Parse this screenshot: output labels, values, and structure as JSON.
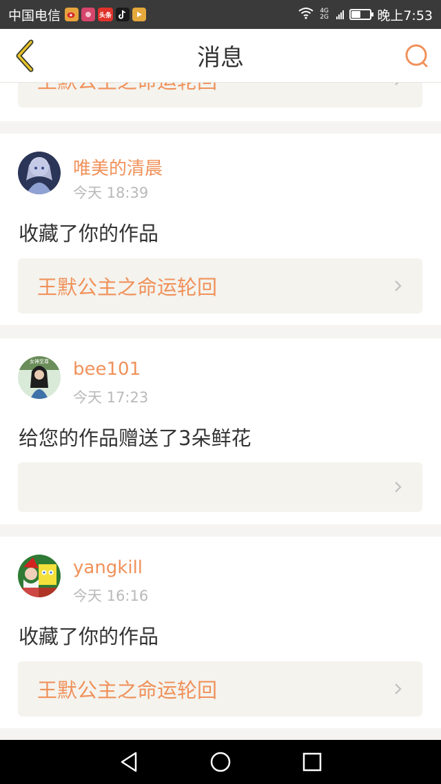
{
  "status_bar": {
    "carrier": "中国电信",
    "apps": [
      "weibo-icon",
      "app-red-icon",
      "toutiao-icon",
      "tiktok-icon",
      "video-icon"
    ],
    "toutiao_label": "头条",
    "network": "4G\n2G",
    "battery_level": 0.45,
    "time": "晚上7:53"
  },
  "header": {
    "title": "消息"
  },
  "top_card": {
    "work_title": "王默公主之命运轮回"
  },
  "notifications": [
    {
      "username": "唯美的清晨",
      "time": "今天 18:39",
      "message": "收藏了你的作品",
      "work_title": "王默公主之命运轮回"
    },
    {
      "username": "bee101",
      "time": "今天 17:23",
      "message": "给您的作品赠送了3朵鲜花",
      "work_title": ""
    },
    {
      "username": "yangkill",
      "time": "今天 16:16",
      "message": "收藏了你的作品",
      "work_title": "王默公主之命运轮回"
    }
  ],
  "colors": {
    "accent": "#f0915a",
    "link_bg": "#f4f3ee",
    "back_arrow": "#c8a21a"
  }
}
